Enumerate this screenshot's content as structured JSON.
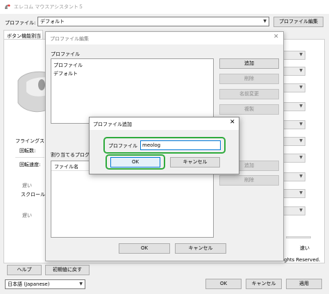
{
  "main": {
    "title": "エレコム マウスアシスタント５",
    "profile_label": "プロファイル:",
    "profile_value": "デフォルト",
    "profile_edit_button": "プロファイル編集",
    "tab_button": "ボタン機能割当",
    "flying_label": "フライングスクロ",
    "rotation_label": "回転数:",
    "rotation_speed_label": "回転速度:",
    "slow_label": "遅い",
    "scroll_speed_label": "スクロール速",
    "slow_label2": "遅い",
    "fast_label": "速い",
    "copyright_fragment": "ghts Reserved.",
    "help_button": "ヘルプ",
    "reset_button": "初期値に戻す",
    "language_value": "日本語 (Japanese)",
    "ok_button": "OK",
    "cancel_button": "キャンセル",
    "apply_button": "適用"
  },
  "profile_edit": {
    "title": "プロファイル編集",
    "profile_group_label": "プロファイル",
    "profiles": [
      "プロファイル",
      "デフォルト"
    ],
    "add_button": "追加",
    "delete_button": "削除",
    "rename_button": "名前変更",
    "copy_button": "複製",
    "assign_label": "割り当てるプログラ",
    "filename_header": "ファイル名",
    "add_button2": "追加",
    "delete_button2": "削除",
    "ok_button": "OK",
    "cancel_button": "キャンセル"
  },
  "add_dialog": {
    "title": "プロファイル追加",
    "name_label": "プロファイル",
    "name_value": "meolog",
    "ok_button": "OK",
    "cancel_button": "キャンセル"
  },
  "colors": {
    "highlight": "#2eaa3c",
    "focus_blue": "#0078d7"
  }
}
